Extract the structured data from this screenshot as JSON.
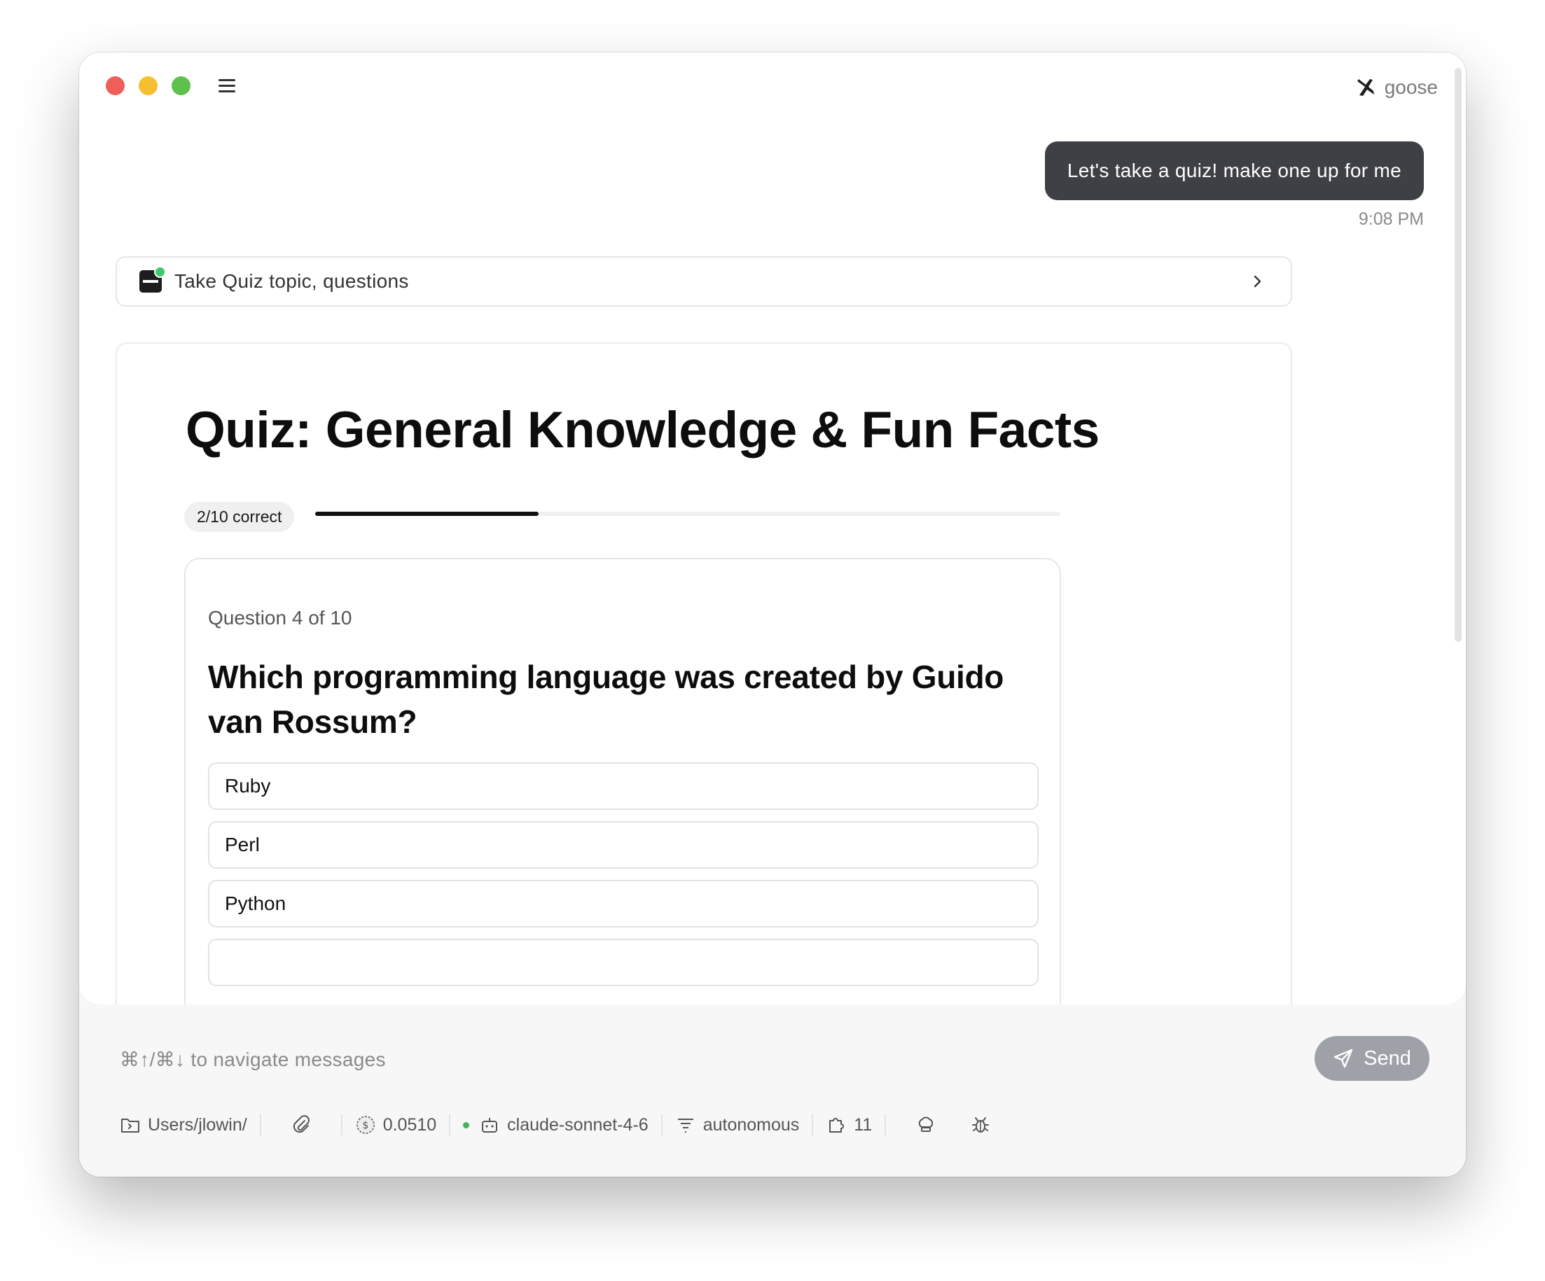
{
  "app": {
    "name": "goose"
  },
  "chat": {
    "user_message": "Let's take a quiz! make one up for me",
    "timestamp": "9:08 PM",
    "tool_call": {
      "label": "Take Quiz topic, questions"
    }
  },
  "quiz": {
    "title": "Quiz: General Knowledge & Fun Facts",
    "score_label": "2/10 correct",
    "progress_fraction": 0.3,
    "question_counter": "Question 4 of 10",
    "question": "Which programming language was created by Guido van Rossum?",
    "options": [
      "Ruby",
      "Perl",
      "Python"
    ]
  },
  "composer": {
    "placeholder": "⌘↑/⌘↓ to navigate messages",
    "send_label": "Send"
  },
  "toolbar": {
    "directory": "Users/jlowin/",
    "cost": "0.0510",
    "model": "claude-sonnet-4-6",
    "mode": "autonomous",
    "extensions_count": "11"
  },
  "colors": {
    "user_bubble": "#3f4045",
    "send_button": "#9ea1a8",
    "status_green": "#42c86a"
  }
}
